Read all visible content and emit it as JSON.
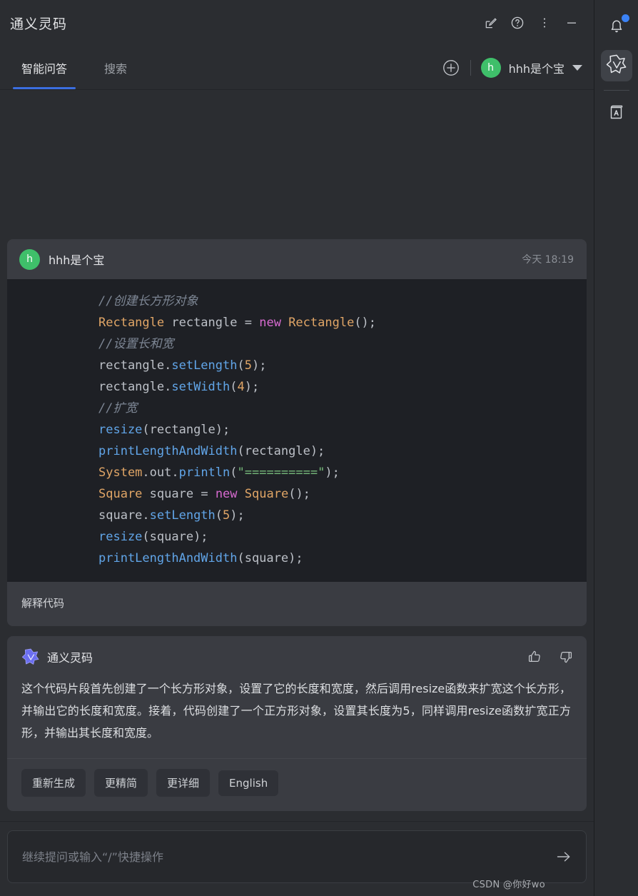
{
  "window": {
    "title": "通义灵码",
    "controls": [
      {
        "name": "compose-icon",
        "label": "新建"
      },
      {
        "name": "help-icon",
        "label": "帮助"
      },
      {
        "name": "more-icon",
        "label": "更多"
      },
      {
        "name": "minimize-icon",
        "label": "最小化"
      }
    ]
  },
  "tabs": [
    {
      "label": "智能问答",
      "active": true
    },
    {
      "label": "搜索",
      "active": false
    }
  ],
  "header_right": {
    "new_chat_icon": "plus-circle-icon",
    "user_name": "hhh是个宝",
    "avatar_letter": "h",
    "dropdown_icon": "chevron-down-icon"
  },
  "message": {
    "avatar_letter": "h",
    "user_name": "hhh是个宝",
    "timestamp": "今天 18:19",
    "code_lines": [
      [
        {
          "t": "//创建长方形对象",
          "c": "cm"
        }
      ],
      [
        {
          "t": "Rectangle",
          "c": "cls"
        },
        {
          "t": " rectangle ",
          "c": "pl"
        },
        {
          "t": "=",
          "c": "pl"
        },
        {
          "t": " ",
          "c": "pl"
        },
        {
          "t": "new",
          "c": "kw"
        },
        {
          "t": " ",
          "c": "pl"
        },
        {
          "t": "Rectangle",
          "c": "cls"
        },
        {
          "t": "();",
          "c": "pl"
        }
      ],
      [
        {
          "t": "//设置长和宽",
          "c": "cm"
        }
      ],
      [
        {
          "t": "rectangle.",
          "c": "pl"
        },
        {
          "t": "setLength",
          "c": "fn"
        },
        {
          "t": "(",
          "c": "pl"
        },
        {
          "t": "5",
          "c": "num"
        },
        {
          "t": ");",
          "c": "pl"
        }
      ],
      [
        {
          "t": "rectangle.",
          "c": "pl"
        },
        {
          "t": "setWidth",
          "c": "fn"
        },
        {
          "t": "(",
          "c": "pl"
        },
        {
          "t": "4",
          "c": "num"
        },
        {
          "t": ");",
          "c": "pl"
        }
      ],
      [
        {
          "t": "//扩宽",
          "c": "cm"
        }
      ],
      [
        {
          "t": "resize",
          "c": "fn"
        },
        {
          "t": "(rectangle);",
          "c": "pl"
        }
      ],
      [
        {
          "t": "printLengthAndWidth",
          "c": "fn"
        },
        {
          "t": "(rectangle);",
          "c": "pl"
        }
      ],
      [
        {
          "t": "System",
          "c": "cls"
        },
        {
          "t": ".out.",
          "c": "pl"
        },
        {
          "t": "println",
          "c": "fn"
        },
        {
          "t": "(",
          "c": "pl"
        },
        {
          "t": "\"==========\"",
          "c": "str"
        },
        {
          "t": ");",
          "c": "pl"
        }
      ],
      [
        {
          "t": "Square",
          "c": "cls"
        },
        {
          "t": " square ",
          "c": "pl"
        },
        {
          "t": "=",
          "c": "pl"
        },
        {
          "t": " ",
          "c": "pl"
        },
        {
          "t": "new",
          "c": "kw"
        },
        {
          "t": " ",
          "c": "pl"
        },
        {
          "t": "Square",
          "c": "cls"
        },
        {
          "t": "();",
          "c": "pl"
        }
      ],
      [
        {
          "t": "square.",
          "c": "pl"
        },
        {
          "t": "setLength",
          "c": "fn"
        },
        {
          "t": "(",
          "c": "pl"
        },
        {
          "t": "5",
          "c": "num"
        },
        {
          "t": ");",
          "c": "pl"
        }
      ],
      [
        {
          "t": "resize",
          "c": "fn"
        },
        {
          "t": "(square);",
          "c": "pl"
        }
      ],
      [
        {
          "t": "printLengthAndWidth",
          "c": "fn"
        },
        {
          "t": "(square);",
          "c": "pl"
        }
      ]
    ],
    "prompt": "解释代码"
  },
  "answer": {
    "assistant_name": "通义灵码",
    "logo_icon": "tongyi-logo-icon",
    "like_icon": "thumbs-up-icon",
    "dislike_icon": "thumbs-down-icon",
    "text": "这个代码片段首先创建了一个长方形对象，设置了它的长度和宽度，然后调用resize函数来扩宽这个长方形，并输出它的长度和宽度。接着，代码创建了一个正方形对象，设置其长度为5，同样调用resize函数扩宽正方形，并输出其长度和宽度。",
    "actions": [
      {
        "label": "重新生成"
      },
      {
        "label": "更精简"
      },
      {
        "label": "更详细"
      },
      {
        "label": "English"
      }
    ]
  },
  "composer": {
    "placeholder": "继续提问或输入“/”快捷操作",
    "value": "",
    "send_icon": "arrow-right-icon"
  },
  "watermark": "CSDN @你好wo",
  "rail": {
    "bell_icon": "bell-icon",
    "has_notification": true,
    "items": [
      {
        "name": "tongyi-logo-icon",
        "active": true
      },
      {
        "name": "dictionary-icon",
        "active": false
      }
    ]
  },
  "colors": {
    "app_bg": "#2b2d31",
    "card_bg": "#3a3c42",
    "code_bg": "#1e2025",
    "accent": "#3b6ee0",
    "avatar_green": "#3fbf6a",
    "logo_purple": "#6b6ef0",
    "notification_blue": "#3b82f6"
  }
}
